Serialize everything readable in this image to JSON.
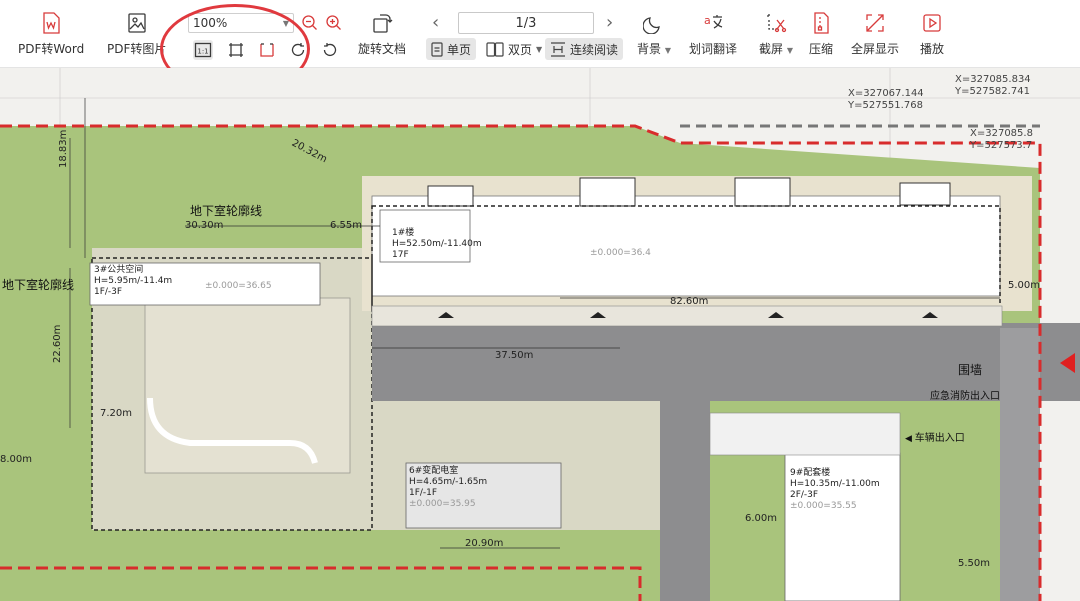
{
  "toolbar": {
    "pdf_to_word": "PDF转Word",
    "pdf_to_image": "PDF转图片",
    "zoom_value": "100%",
    "rotate_doc": "旋转文档",
    "page_indicator": "1/3",
    "single_page": "单页",
    "double_page": "双页",
    "continuous": "连续阅读",
    "background": "背景",
    "word_translate": "划词翻译",
    "screenshot": "截屏",
    "compress": "压缩",
    "fullscreen": "全屏显示",
    "play": "播放",
    "actual_size": "1:1"
  },
  "drawing": {
    "label_basement_1": "地下室轮廓线",
    "label_basement_2": "地下室轮廓线",
    "dim_3030": "30.30m",
    "dim_655": "6.55m",
    "dim_1883": "18.83m",
    "dim_2260": "22.60m",
    "dim_800": "8.00m",
    "dim_720": "7.20m",
    "dim_2090": "20.90m",
    "dim_3750": "37.50m",
    "dim_8260": "82.60m",
    "dim_2925": "20.32m",
    "dim_600": "6.00m",
    "dim_500": "5.00m",
    "dim_550": "5.50m",
    "building1_title": "1#楼",
    "building1_h": "H=52.50m/-11.40m",
    "building1_f": "17F",
    "building1_elev": "±0.000=36.4",
    "building3_title": "3#公共空间",
    "building3_h": "H=5.95m/-11.4m",
    "building3_f": "1F/-3F",
    "building3_elev": "±0.000=36.65",
    "building6_title": "6#变配电室",
    "building6_h": "H=4.65m/-1.65m",
    "building6_f": "1F/-1F",
    "building6_elev": "±0.000=35.95",
    "building9_title": "9#配套楼",
    "building9_h": "H=10.35m/-11.00m",
    "building9_f": "2F/-3F",
    "building9_elev": "±0.000=35.55",
    "wall_label": "围墙",
    "emergency_exit": "应急消防出入口",
    "vehicle_exit": "车辆出入口",
    "coord_1": "X=327085.834",
    "coord_2": "Y=527582.741",
    "coord_3": "X=327067.144",
    "coord_4": "Y=527551.768",
    "coord_5": "X=327085.8",
    "coord_6": "Y=527573.7"
  }
}
